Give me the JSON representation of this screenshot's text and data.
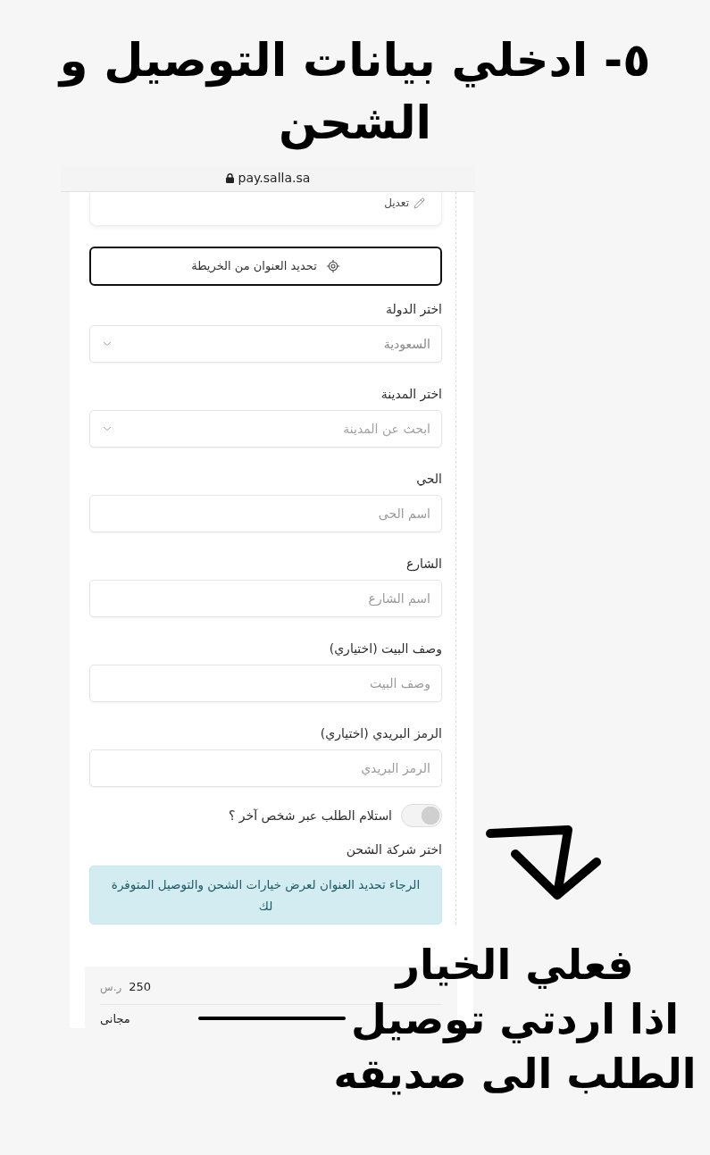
{
  "heading": "٥- ادخلي بيانات التوصيل و\nالشحن",
  "browser": {
    "url": "pay.salla.sa"
  },
  "address_card": {
    "edit_link": "تعديل"
  },
  "map_button": {
    "label": "تحديد العنوان من الخريطة"
  },
  "fields": [
    {
      "kind": "select",
      "label": "اختر الدولة",
      "value": "السعودية"
    },
    {
      "kind": "select",
      "label": "اختر المدينة",
      "placeholder": "ابحث عن المدينة"
    },
    {
      "kind": "text",
      "label": "الحي",
      "placeholder": "اسم الحى"
    },
    {
      "kind": "text",
      "label": "الشارع",
      "placeholder": "اسم الشارع"
    },
    {
      "kind": "text",
      "label": "وصف البيت (اختياري)",
      "placeholder": "وصف البيت"
    },
    {
      "kind": "text",
      "label": "الرمز البريدي (اختياري)",
      "placeholder": "الرمز البريدي"
    }
  ],
  "pickup_toggle": {
    "label": "استلام الطلب عبر شخص آخر ؟",
    "on": false
  },
  "shipping": {
    "label": "اختر شركة الشحن",
    "notice": "الرجاء تحديد العنوان لعرض خيارات الشحن والتوصيل المتوفرة لك"
  },
  "summary": {
    "rows": [
      {
        "amount": "250",
        "currency": "ر.س"
      },
      {
        "amount": "مجانى"
      }
    ]
  },
  "annotation": {
    "text": "فعلي الخيار\nاذا اردتي توصيل\nالطلب الى صديقه"
  }
}
